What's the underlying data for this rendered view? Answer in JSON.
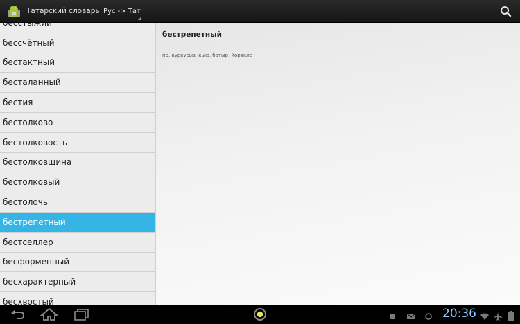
{
  "app": {
    "title": "Татарский словарь",
    "direction": "Рус -> Тат"
  },
  "list": {
    "items": [
      {
        "word": "бесстыжий",
        "selected": false
      },
      {
        "word": "бессчётный",
        "selected": false
      },
      {
        "word": "бестактный",
        "selected": false
      },
      {
        "word": "бесталанный",
        "selected": false
      },
      {
        "word": "бестия",
        "selected": false
      },
      {
        "word": "бестолково",
        "selected": false
      },
      {
        "word": "бестолковость",
        "selected": false
      },
      {
        "word": "бестолковщина",
        "selected": false
      },
      {
        "word": "бестолковый",
        "selected": false
      },
      {
        "word": "бестолочь",
        "selected": false
      },
      {
        "word": "бестрепетный",
        "selected": true
      },
      {
        "word": "бестселлер",
        "selected": false
      },
      {
        "word": "бесформенный",
        "selected": false
      },
      {
        "word": "бесхарактерный",
        "selected": false
      },
      {
        "word": "бесхвостый",
        "selected": false
      }
    ]
  },
  "detail": {
    "word": "бестрепетный",
    "translation": "пр. куркусыз, кыю, батыр, йөрәкле"
  },
  "system": {
    "clock": "20:36"
  },
  "icons": {
    "app": "android-icon",
    "search": "search-icon",
    "back": "back-icon",
    "home": "home-icon",
    "recents": "recent-apps-icon",
    "menu": "menu-icon"
  },
  "colors": {
    "selected": "#35b5e5",
    "clock": "#8fc9ff"
  }
}
